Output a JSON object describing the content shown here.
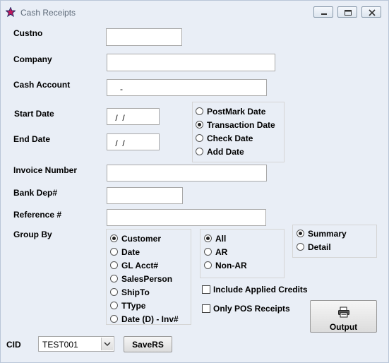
{
  "window": {
    "title": "Cash Receipts",
    "icon": "star-icon"
  },
  "form": {
    "custno": {
      "label": "Custno",
      "value": ""
    },
    "company": {
      "label": "Company",
      "value": ""
    },
    "cash_account": {
      "label": "Cash Account",
      "value": "   -"
    },
    "start_date": {
      "label": "Start Date",
      "value": " /  /"
    },
    "end_date": {
      "label": "End Date",
      "value": " /  /"
    },
    "invoice_number": {
      "label": "Invoice Number",
      "value": ""
    },
    "bank_dep": {
      "label": "Bank Dep#",
      "value": ""
    },
    "reference": {
      "label": "Reference #",
      "value": ""
    },
    "group_by_label": "Group By",
    "cid": {
      "label": "CID",
      "value": "TEST001"
    }
  },
  "date_type": {
    "options": [
      "PostMark Date",
      "Transaction Date",
      "Check Date",
      "Add Date"
    ],
    "selected": "Transaction Date"
  },
  "group_by": {
    "options": [
      "Customer",
      "Date",
      "GL Acct#",
      "SalesPerson",
      "ShipTo",
      "TType",
      "Date (D) - Inv#"
    ],
    "selected": "Customer"
  },
  "ar_filter": {
    "options": [
      "All",
      "AR",
      "Non-AR"
    ],
    "selected": "All"
  },
  "report_type": {
    "options": [
      "Summary",
      "Detail"
    ],
    "selected": "Summary"
  },
  "checks": {
    "include_applied_credits": {
      "label": "Include Applied Credits",
      "checked": false
    },
    "only_pos_receipts": {
      "label": "Only POS Receipts",
      "checked": false
    }
  },
  "buttons": {
    "save_rs": "SaveRS",
    "output": "Output"
  }
}
